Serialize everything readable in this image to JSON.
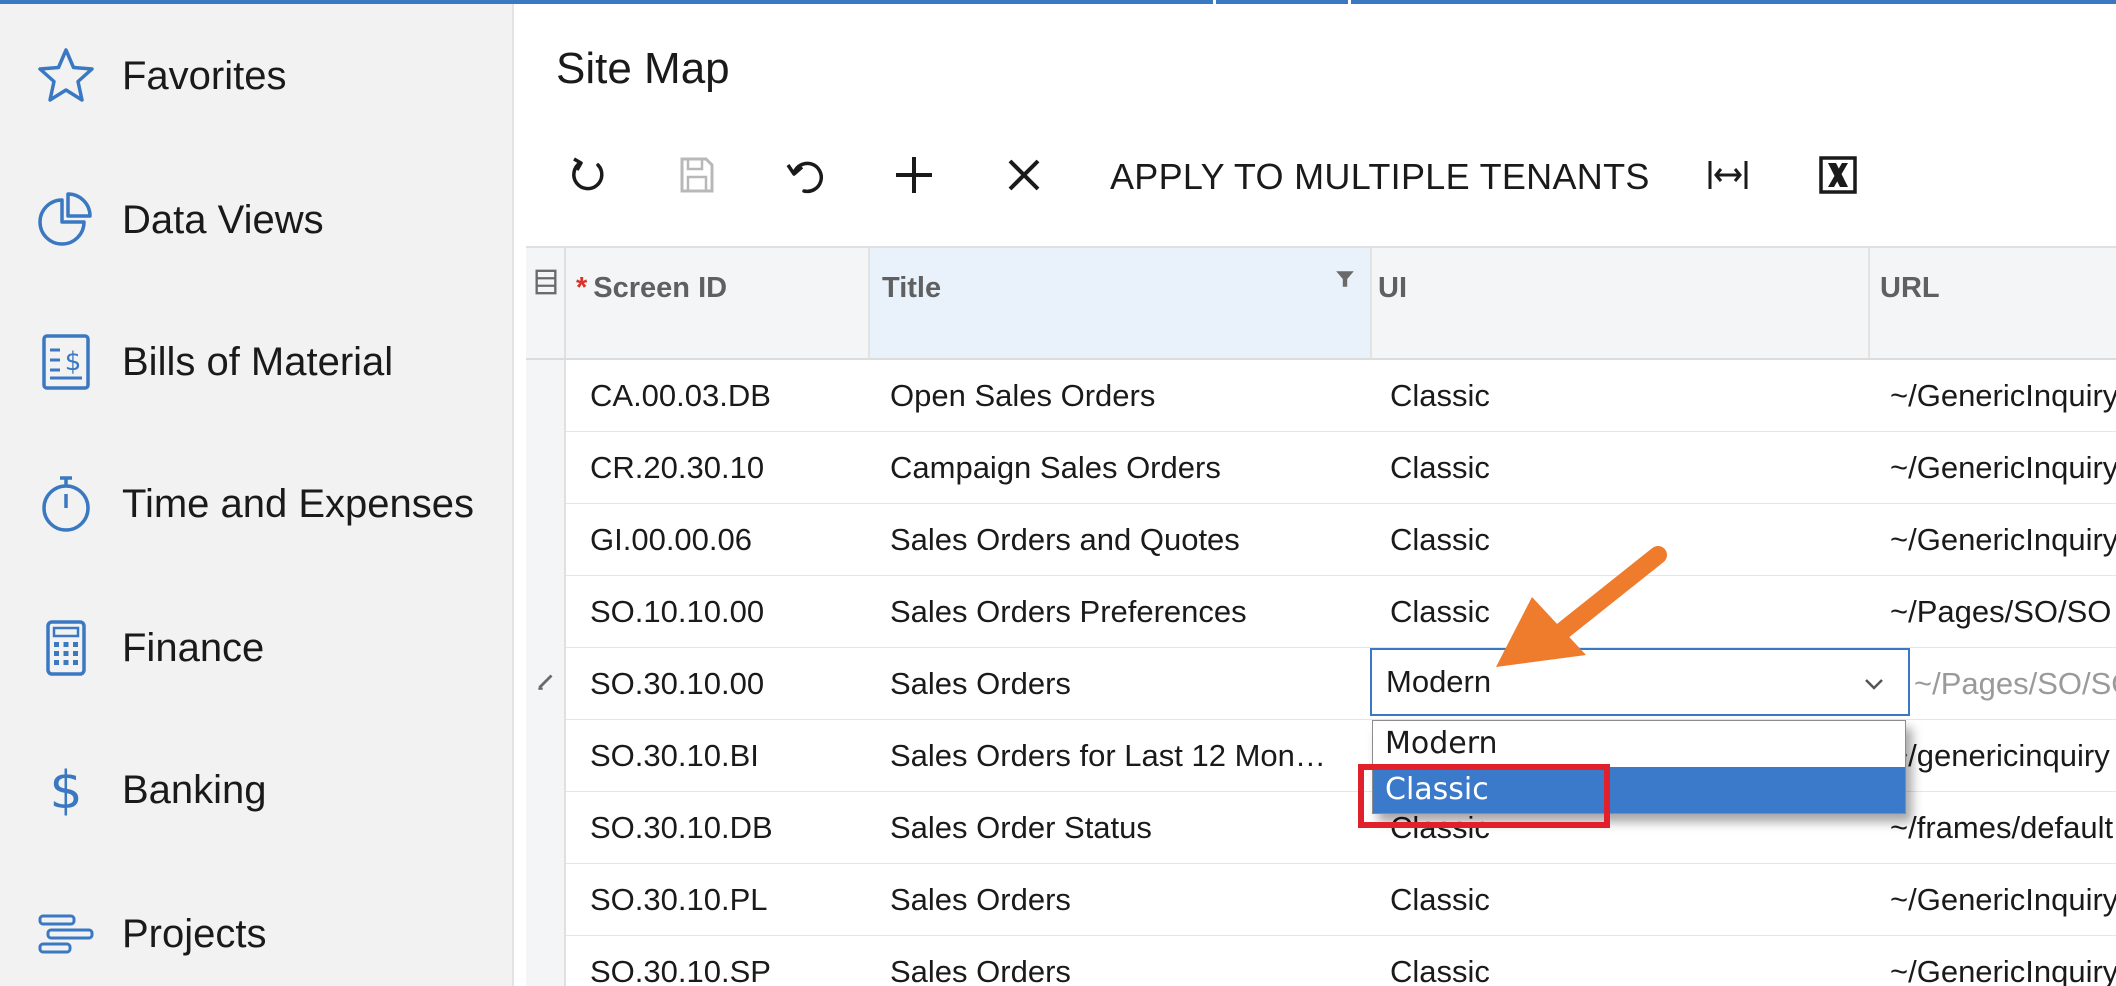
{
  "sidebar": {
    "items": [
      {
        "label": "Favorites",
        "icon": "star-icon"
      },
      {
        "label": "Data Views",
        "icon": "pie-chart-icon"
      },
      {
        "label": "Bills of Material",
        "icon": "bill-dollar-icon"
      },
      {
        "label": "Time and Expenses",
        "icon": "stopwatch-icon"
      },
      {
        "label": "Finance",
        "icon": "calculator-icon"
      },
      {
        "label": "Banking",
        "icon": "dollar-icon"
      },
      {
        "label": "Projects",
        "icon": "gantt-icon"
      }
    ]
  },
  "page": {
    "title": "Site Map"
  },
  "toolbar": {
    "refresh_icon": "refresh-icon",
    "save_icon": "save-icon",
    "undo_icon": "undo-icon",
    "add_icon": "add-icon",
    "delete_icon": "delete-icon",
    "apply_label": "APPLY TO MULTIPLE TENANTS",
    "fit_icon": "fit-columns-icon",
    "excel_icon": "export-excel-icon"
  },
  "grid": {
    "columns": {
      "required_mark": "*",
      "screen_id": "Screen ID",
      "title": "Title",
      "ui": "UI",
      "url": "URL"
    },
    "rows": [
      {
        "screen_id": "CA.00.03.DB",
        "title": "Open Sales Orders",
        "ui": "Classic",
        "url": "~/GenericInquiry"
      },
      {
        "screen_id": "CR.20.30.10",
        "title": "Campaign Sales Orders",
        "ui": "Classic",
        "url": "~/GenericInquiry"
      },
      {
        "screen_id": "GI.00.00.06",
        "title": "Sales Orders and Quotes",
        "ui": "Classic",
        "url": "~/GenericInquiry"
      },
      {
        "screen_id": "SO.10.10.00",
        "title": "Sales Orders Preferences",
        "ui": "Classic",
        "url": "~/Pages/SO/SO"
      },
      {
        "screen_id": "SO.30.10.00",
        "title": "Sales Orders",
        "ui": "Modern",
        "url": "~/Pages/SO/SO"
      },
      {
        "screen_id": "SO.30.10.BI",
        "title": "Sales Orders for Last 12 Mon…",
        "ui": "",
        "url": "~/genericinquiry"
      },
      {
        "screen_id": "SO.30.10.DB",
        "title": "Sales Order Status",
        "ui": "Classic",
        "url": "~/frames/default"
      },
      {
        "screen_id": "SO.30.10.PL",
        "title": "Sales Orders",
        "ui": "Classic",
        "url": "~/GenericInquiry"
      },
      {
        "screen_id": "SO.30.10.SP",
        "title": "Sales Orders",
        "ui": "Classic",
        "url": "~/GenericInquiry"
      }
    ]
  },
  "ui_dropdown": {
    "value": "Modern",
    "options": [
      "Modern",
      "Classic"
    ],
    "highlighted": "Classic"
  },
  "colors": {
    "accent": "#3a78c2",
    "selected_option": "#3b7acb",
    "annotation_arrow": "#ef7b2c",
    "annotation_box": "#e0202b"
  }
}
